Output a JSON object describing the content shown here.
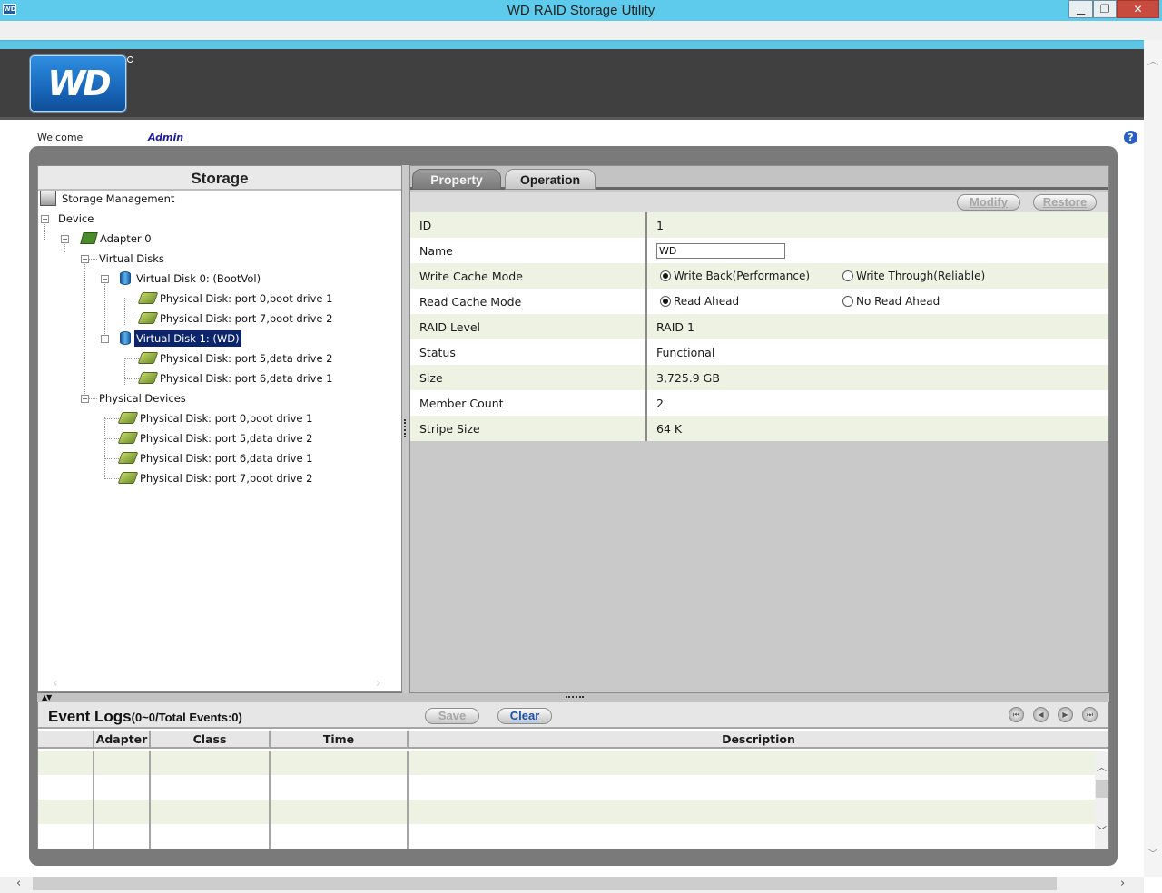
{
  "window": {
    "title": "WD RAID Storage Utility",
    "icon_text": "WD",
    "controls": [
      "minimize",
      "maximize",
      "close"
    ]
  },
  "header": {
    "logo_text": "WD",
    "welcome_label": "Welcome",
    "user": "Admin"
  },
  "storage": {
    "title": "Storage",
    "tree": {
      "storage_management": "Storage Management",
      "device": "Device",
      "adapter": "Adapter 0",
      "virtual_disks": "Virtual Disks",
      "vd0": "Virtual Disk 0: (BootVol)",
      "vd0_pd1": "Physical Disk: port 0,boot drive 1",
      "vd0_pd2": "Physical Disk: port 7,boot drive 2",
      "vd1": "Virtual Disk 1: (WD)",
      "vd1_pd1": "Physical Disk: port 5,data drive 2",
      "vd1_pd2": "Physical Disk: port 6,data drive 1",
      "physical_devices": "Physical Devices",
      "pd_list": [
        "Physical Disk: port 0,boot drive 1",
        "Physical Disk: port 5,data drive 2",
        "Physical Disk: port 6,data drive 1",
        "Physical Disk: port 7,boot drive 2"
      ]
    }
  },
  "tabs": {
    "property": "Property",
    "operation": "Operation",
    "active": "property"
  },
  "toolbar": {
    "modify": "Modify",
    "restore": "Restore"
  },
  "properties": {
    "id": {
      "label": "ID",
      "value": "1"
    },
    "name": {
      "label": "Name",
      "value": "WD"
    },
    "write_cache": {
      "label": "Write Cache Mode",
      "options": [
        "Write Back(Performance)",
        "Write Through(Reliable)"
      ],
      "selected": 0
    },
    "read_cache": {
      "label": "Read Cache Mode",
      "options": [
        "Read Ahead",
        "No Read Ahead"
      ],
      "selected": 0
    },
    "raid_level": {
      "label": "RAID Level",
      "value": "RAID 1"
    },
    "status": {
      "label": "Status",
      "value": "Functional"
    },
    "size": {
      "label": "Size",
      "value": "3,725.9 GB"
    },
    "member_count": {
      "label": "Member Count",
      "value": "2"
    },
    "stripe_size": {
      "label": "Stripe Size",
      "value": "64 K"
    }
  },
  "event_logs": {
    "title": "Event Logs",
    "count": "(0~0/Total Events:0)",
    "save": "Save",
    "clear": "Clear",
    "columns": [
      "Adapter",
      "Class",
      "Time",
      "Description"
    ]
  },
  "colors": {
    "titlebar": "#5ecbec",
    "header": "#404040",
    "row_alt": "#edf2e2",
    "selection": "#0c246a",
    "frame": "#7a7a7a"
  }
}
